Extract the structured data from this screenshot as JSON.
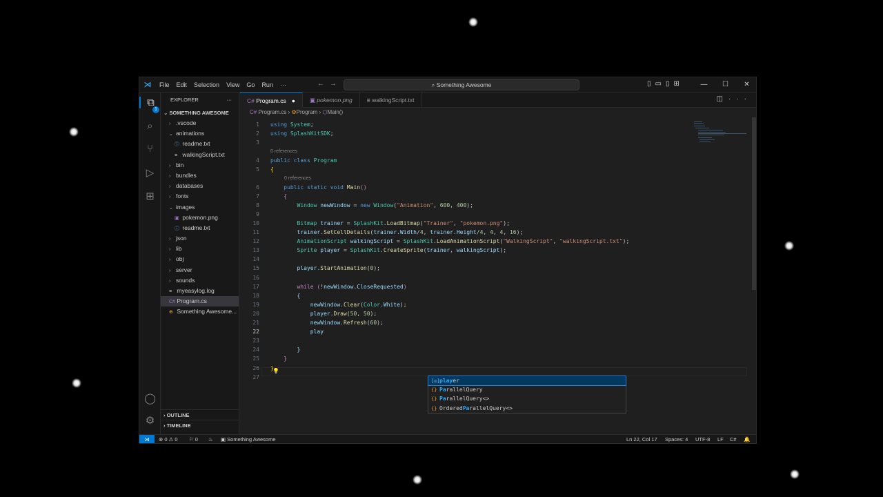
{
  "window": {
    "menu": [
      "File",
      "Edit",
      "Selection",
      "View",
      "Go",
      "Run",
      "···"
    ],
    "search": "Something Awesome",
    "controls": [
      "—",
      "☐",
      "✕"
    ]
  },
  "sidebar": {
    "header": "EXPLORER",
    "more": "···",
    "project": "SOMETHING AWESOME",
    "items": [
      {
        "label": ".vscode",
        "depth": 0,
        "type": "folder",
        "open": false
      },
      {
        "label": "animations",
        "depth": 0,
        "type": "folder",
        "open": true
      },
      {
        "label": "readme.txt",
        "depth": 1,
        "type": "info"
      },
      {
        "label": "walkingScript.txt",
        "depth": 1,
        "type": "text"
      },
      {
        "label": "bin",
        "depth": 0,
        "type": "folder",
        "open": false
      },
      {
        "label": "bundles",
        "depth": 0,
        "type": "folder",
        "open": false
      },
      {
        "label": "databases",
        "depth": 0,
        "type": "folder",
        "open": false
      },
      {
        "label": "fonts",
        "depth": 0,
        "type": "folder",
        "open": false
      },
      {
        "label": "images",
        "depth": 0,
        "type": "folder",
        "open": true
      },
      {
        "label": "pokemon.png",
        "depth": 1,
        "type": "image"
      },
      {
        "label": "readme.txt",
        "depth": 1,
        "type": "info"
      },
      {
        "label": "json",
        "depth": 0,
        "type": "folder",
        "open": false
      },
      {
        "label": "lib",
        "depth": 0,
        "type": "folder",
        "open": false
      },
      {
        "label": "obj",
        "depth": 0,
        "type": "folder",
        "open": false
      },
      {
        "label": "server",
        "depth": 0,
        "type": "folder",
        "open": false
      },
      {
        "label": "sounds",
        "depth": 0,
        "type": "folder",
        "open": false
      },
      {
        "label": "myeasylog.log",
        "depth": 0,
        "type": "log"
      },
      {
        "label": "Program.cs",
        "depth": 0,
        "type": "cs",
        "selected": true
      },
      {
        "label": "Something Awesome...",
        "depth": 0,
        "type": "proj"
      }
    ],
    "outline": "OUTLINE",
    "timeline": "TIMELINE"
  },
  "tabs": [
    {
      "label": "Program.cs",
      "active": true,
      "modified": true,
      "italic": false
    },
    {
      "label": "pokemon.png",
      "active": false,
      "modified": false,
      "italic": true
    },
    {
      "label": "walkingScript.txt",
      "active": false,
      "modified": false,
      "italic": false
    }
  ],
  "breadcrumb": [
    "Program.cs",
    "Program",
    "Main()"
  ],
  "editor": {
    "lenses": [
      "0 references",
      "0 references"
    ],
    "lines": [
      {
        "n": "1",
        "tokens": [
          [
            "k",
            "using"
          ],
          [
            "p",
            " "
          ],
          [
            "t",
            "System"
          ],
          [
            "p",
            ";"
          ]
        ]
      },
      {
        "n": "2",
        "tokens": [
          [
            "k",
            "using"
          ],
          [
            "p",
            " "
          ],
          [
            "t",
            "SplashKitSDK"
          ],
          [
            "p",
            ";"
          ]
        ]
      },
      {
        "n": "3",
        "tokens": []
      },
      {
        "n": "4",
        "tokens": [
          [
            "k",
            "public"
          ],
          [
            "p",
            " "
          ],
          [
            "k",
            "class"
          ],
          [
            "p",
            " "
          ],
          [
            "t",
            "Program"
          ]
        ]
      },
      {
        "n": "5",
        "tokens": [
          [
            "b",
            "{"
          ]
        ]
      },
      {
        "n": "6",
        "tokens": [
          [
            "p",
            "    "
          ],
          [
            "k",
            "public"
          ],
          [
            "p",
            " "
          ],
          [
            "k",
            "static"
          ],
          [
            "p",
            " "
          ],
          [
            "k",
            "void"
          ],
          [
            "p",
            " "
          ],
          [
            "f",
            "Main"
          ],
          [
            "kc",
            "()"
          ]
        ]
      },
      {
        "n": "7",
        "tokens": [
          [
            "p",
            "    "
          ],
          [
            "kc",
            "{"
          ]
        ]
      },
      {
        "n": "8",
        "tokens": [
          [
            "p",
            "        "
          ],
          [
            "t",
            "Window"
          ],
          [
            "p",
            " "
          ],
          [
            "v",
            "newWindow"
          ],
          [
            "p",
            " = "
          ],
          [
            "k",
            "new"
          ],
          [
            "p",
            " "
          ],
          [
            "t",
            "Window"
          ],
          [
            "p",
            "("
          ],
          [
            "s",
            "\"Animation\""
          ],
          [
            "p",
            ", "
          ],
          [
            "n",
            "600"
          ],
          [
            "p",
            ", "
          ],
          [
            "n",
            "400"
          ],
          [
            "p",
            ");"
          ]
        ]
      },
      {
        "n": "9",
        "tokens": []
      },
      {
        "n": "10",
        "tokens": [
          [
            "p",
            "        "
          ],
          [
            "t",
            "Bitmap"
          ],
          [
            "p",
            " "
          ],
          [
            "v",
            "trainer"
          ],
          [
            "p",
            " = "
          ],
          [
            "t",
            "SplashKit"
          ],
          [
            "p",
            "."
          ],
          [
            "f",
            "LoadBitmap"
          ],
          [
            "p",
            "("
          ],
          [
            "s",
            "\"Trainer\""
          ],
          [
            "p",
            ", "
          ],
          [
            "s",
            "\"pokemon.png\""
          ],
          [
            "p",
            ");"
          ]
        ]
      },
      {
        "n": "11",
        "tokens": [
          [
            "p",
            "        "
          ],
          [
            "v",
            "trainer"
          ],
          [
            "p",
            "."
          ],
          [
            "f",
            "SetCellDetails"
          ],
          [
            "p",
            "("
          ],
          [
            "v",
            "trainer"
          ],
          [
            "p",
            "."
          ],
          [
            "v",
            "Width"
          ],
          [
            "p",
            "/"
          ],
          [
            "n",
            "4"
          ],
          [
            "p",
            ", "
          ],
          [
            "v",
            "trainer"
          ],
          [
            "p",
            "."
          ],
          [
            "v",
            "Height"
          ],
          [
            "p",
            "/"
          ],
          [
            "n",
            "4"
          ],
          [
            "p",
            ", "
          ],
          [
            "n",
            "4"
          ],
          [
            "p",
            ", "
          ],
          [
            "n",
            "4"
          ],
          [
            "p",
            ", "
          ],
          [
            "n",
            "16"
          ],
          [
            "p",
            ");"
          ]
        ]
      },
      {
        "n": "12",
        "tokens": [
          [
            "p",
            "        "
          ],
          [
            "t",
            "AnimationScript"
          ],
          [
            "p",
            " "
          ],
          [
            "v",
            "walkingScript"
          ],
          [
            "p",
            " = "
          ],
          [
            "t",
            "SplashKit"
          ],
          [
            "p",
            "."
          ],
          [
            "f",
            "LoadAnimationScript"
          ],
          [
            "p",
            "("
          ],
          [
            "s",
            "\"WalkingScript\""
          ],
          [
            "p",
            ", "
          ],
          [
            "s",
            "\"walkingScript.txt\""
          ],
          [
            "p",
            ");"
          ]
        ]
      },
      {
        "n": "13",
        "tokens": [
          [
            "p",
            "        "
          ],
          [
            "t",
            "Sprite"
          ],
          [
            "p",
            " "
          ],
          [
            "v",
            "player"
          ],
          [
            "p",
            " = "
          ],
          [
            "t",
            "SplashKit"
          ],
          [
            "p",
            "."
          ],
          [
            "f",
            "CreateSprite"
          ],
          [
            "p",
            "("
          ],
          [
            "v",
            "trainer"
          ],
          [
            "p",
            ", "
          ],
          [
            "v",
            "walkingScript"
          ],
          [
            "p",
            ");"
          ]
        ]
      },
      {
        "n": "14",
        "tokens": []
      },
      {
        "n": "15",
        "tokens": [
          [
            "p",
            "        "
          ],
          [
            "v",
            "player"
          ],
          [
            "p",
            "."
          ],
          [
            "f",
            "StartAnimation"
          ],
          [
            "p",
            "("
          ],
          [
            "n",
            "0"
          ],
          [
            "p",
            ");"
          ]
        ]
      },
      {
        "n": "16",
        "tokens": []
      },
      {
        "n": "17",
        "tokens": [
          [
            "p",
            "        "
          ],
          [
            "kc",
            "while"
          ],
          [
            "p",
            " "
          ],
          [
            "kc",
            "("
          ],
          [
            "p",
            "!"
          ],
          [
            "v",
            "newWindow"
          ],
          [
            "p",
            "."
          ],
          [
            "v",
            "CloseRequested"
          ],
          [
            "kc",
            ")"
          ]
        ]
      },
      {
        "n": "18",
        "tokens": [
          [
            "p",
            "        "
          ],
          [
            "v",
            "{"
          ]
        ]
      },
      {
        "n": "19",
        "tokens": [
          [
            "p",
            "            "
          ],
          [
            "v",
            "newWindow"
          ],
          [
            "p",
            "."
          ],
          [
            "f",
            "Clear"
          ],
          [
            "p",
            "("
          ],
          [
            "t",
            "Color"
          ],
          [
            "p",
            "."
          ],
          [
            "v",
            "White"
          ],
          [
            "p",
            ");"
          ]
        ]
      },
      {
        "n": "20",
        "tokens": [
          [
            "p",
            "            "
          ],
          [
            "v",
            "player"
          ],
          [
            "p",
            "."
          ],
          [
            "f",
            "Draw"
          ],
          [
            "p",
            "("
          ],
          [
            "n",
            "50"
          ],
          [
            "p",
            ", "
          ],
          [
            "n",
            "50"
          ],
          [
            "p",
            ");"
          ]
        ]
      },
      {
        "n": "21",
        "tokens": [
          [
            "p",
            "            "
          ],
          [
            "v",
            "newWindow"
          ],
          [
            "p",
            "."
          ],
          [
            "f",
            "Refresh"
          ],
          [
            "p",
            "("
          ],
          [
            "n",
            "60"
          ],
          [
            "p",
            ");"
          ]
        ]
      },
      {
        "n": "22",
        "tokens": [
          [
            "p",
            "            "
          ],
          [
            "v",
            "play"
          ]
        ]
      },
      {
        "n": "23",
        "tokens": []
      },
      {
        "n": "24",
        "tokens": [
          [
            "p",
            "        "
          ],
          [
            "v",
            "}"
          ]
        ]
      },
      {
        "n": "25",
        "tokens": [
          [
            "p",
            "    "
          ],
          [
            "kc",
            "}"
          ]
        ]
      },
      {
        "n": "26",
        "tokens": [
          [
            "b",
            "}"
          ]
        ]
      },
      {
        "n": "27",
        "tokens": []
      }
    ]
  },
  "suggestions": [
    {
      "icon": "[◎]",
      "pre": "",
      "match": "play",
      "post": "er",
      "selected": true
    },
    {
      "icon": "{}",
      "pre": "",
      "match": "Pa",
      "post": "rallelQuery",
      "selected": false
    },
    {
      "icon": "{}",
      "pre": "",
      "match": "Pa",
      "post": "rallelQuery<>",
      "selected": false
    },
    {
      "icon": "{}",
      "pre": "Ordered",
      "match": "Pa",
      "post": "rallelQuery<>",
      "selected": false
    }
  ],
  "status": {
    "errors": "⊗ 0 ⚠ 0",
    "ports": "⚐ 0",
    "project": "Something Awesome",
    "position": "Ln 22, Col 17",
    "spaces": "Spaces: 4",
    "encoding": "UTF-8",
    "eol": "LF",
    "language": "C#"
  },
  "colors": {
    "accent": "#0078d4",
    "editor_bg": "#1f1f1f",
    "chrome_bg": "#181818"
  }
}
